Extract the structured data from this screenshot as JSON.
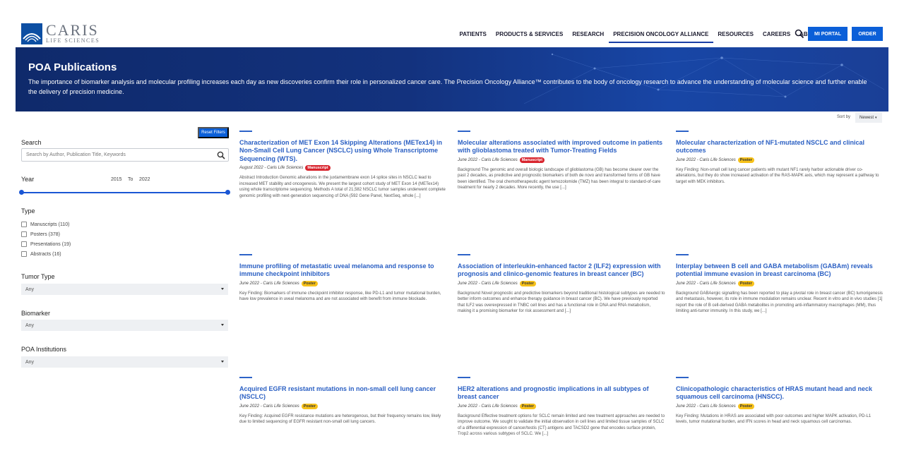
{
  "header": {
    "logo_name": "CARIS",
    "logo_sub": "LIFE SCIENCES",
    "nav": [
      {
        "label": "PATIENTS",
        "active": false
      },
      {
        "label": "PRODUCTS & SERVICES",
        "active": false
      },
      {
        "label": "RESEARCH",
        "active": false
      },
      {
        "label": "PRECISION ONCOLOGY ALLIANCE",
        "active": true
      },
      {
        "label": "RESOURCES",
        "active": false
      },
      {
        "label": "CAREERS",
        "active": false
      },
      {
        "label": "ABOUT",
        "active": false
      }
    ],
    "portal_label": "MI PORTAL",
    "order_label": "ORDER"
  },
  "hero": {
    "title": "POA Publications",
    "text": "The importance of biomarker analysis and molecular profiling increases each day as new discoveries confirm their role in personalized cancer care. The Precision Oncology Alliance™ contributes to the body of oncology research to advance the understanding of molecular science and further enable the delivery of precision medicine."
  },
  "sort": {
    "label": "Sort by",
    "value": "Newest"
  },
  "sidebar": {
    "reset_label": "Reset Filters",
    "search_label": "Search",
    "search_placeholder": "Search by Author, Publication Title, Keywords",
    "year_label": "Year",
    "year_from": "2015",
    "year_to_word": "To",
    "year_to": "2022",
    "type_label": "Type",
    "types": [
      "Manuscripts (110)",
      "Posters (378)",
      "Presentations (19)",
      "Abstracts (16)"
    ],
    "tumor_label": "Tumor Type",
    "tumor_value": "Any",
    "biomarker_label": "Biomarker",
    "biomarker_value": "Any",
    "institutions_label": "POA Institutions",
    "institutions_value": "Any"
  },
  "cards": [
    {
      "title": "Characterization of MET Exon 14 Skipping Alterations (METex14) in Non-Small Cell Lung Cancer (NSCLC) using Whole Transcriptome Sequencing (WTS).",
      "meta": "August 2022 - Caris Life Sciences",
      "badge": "Manuscript",
      "body": "Abstract Introduction Genomic alterations in the juxtamembrane exon 14 splice sites in NSCLC lead to increased MET stability and oncogenesis. We present the largest cohort study of MET Exon 14 (METex14) using whole transcriptome sequencing. Methods A total of 21,582 NSCLC tumor samples underwent complete genomic profiling with next-generation sequencing of DNA (592 Gene Panel, NextSeq, whole [...]"
    },
    {
      "title": "Molecular alterations associated with improved outcome in patients with glioblastoma treated with Tumor-Treating Fields",
      "meta": "June 2022 - Caris Life Sciences",
      "badge": "Manuscript",
      "body": "Background The genomic and overall biologic landscape of glioblastoma (GB) has become clearer over the past 2 decades, as predictive and prognostic biomarkers of both de novo and transformed forms of GB have been identified. The oral chemotherapeutic agent temozolomide (TMZ) has been integral to standard-of-care treatment for nearly 2 decades. More recently, the use [...]"
    },
    {
      "title": "Molecular characterization of NF1-mutated NSCLC and clinical outcomes",
      "meta": "June 2022 - Caris Life Sciences",
      "badge": "Poster",
      "body": "Key Finding: Non-small cell lung cancer patients with mutant NF1 rarely harbor actionable driver co-alterations, but they do show increased activation of the RAS-MAPK axis, which may represent a pathway to target with MEK inhibitors."
    },
    {
      "title": "Immune profiling of metastatic uveal melanoma and response to immune checkpoint inhibitors",
      "meta": "June 2022 - Caris Life Sciences",
      "badge": "Poster",
      "body": "Key Finding: Biomarkers of immune checkpoint inhibitor response, like PD-L1 and tumor mutational burden, have low prevalence in uveal melanoma and are not associated with benefit from immune blockade."
    },
    {
      "title": "Association of interleukin-enhanced factor 2 (ILF2) expression with prognosis and clinico-genomic features in breast cancer (BC)",
      "meta": "June 2022 - Caris Life Sciences",
      "badge": "Poster",
      "body": "Background Novel prognostic and predictive biomarkers beyond traditional histological subtypes are needed to better inform outcomes and enhance therapy guidance in breast cancer (BC). We have previously reported that ILF2 was overexpressed in TNBC cell lines and has a functional role in DNA and RNA metabolism, making it a promising biomarker for risk assessment and [...]"
    },
    {
      "title": "Interplay between B cell and GABA metabolism (GABAm) reveals potential immune evasion in breast carcinoma (BC)",
      "meta": "June 2022 - Caris Life Sciences",
      "badge": "Poster",
      "body": "Background GABAergic signalling has been reported to play a pivotal role in breast cancer (BC) tumorigenesis and metastasis, however, its role in immune modulation remains unclear. Recent in vitro and in vivo studies [1] report the role of B cell-derived GABA metabolites in promoting anti-inflammatory macrophages (MM), thus limiting anti-tumor immunity. In this study, we [...]"
    },
    {
      "title": "Acquired EGFR resistant mutations in non-small cell lung cancer (NSCLC)",
      "meta": "June 2022 - Caris Life Sciences",
      "badge": "Poster",
      "body": "Key Finding: Acquired EGFR resistance mutations are heterogenous, but their frequency remains low, likely due to limited sequencing of EGFR resistant non-small cell lung cancers."
    },
    {
      "title": "HER2 alterations and prognostic implications in all subtypes of breast cancer",
      "meta": "June 2022 - Caris Life Sciences",
      "badge": "Poster",
      "body": "Background Effective treatment options for SCLC remain limited and new treatment approaches are needed to improve outcome. We sought to validate the initial observation in cell lines and limited tissue samples of SCLC of a differential expression of cancer/testis (CT) antigens and TACSD2 gene that encodes surface protein, Trop2 across various subtypes of SCLC. We [...]"
    },
    {
      "title": "Clinicopathologic characteristics of HRAS mutant head and neck squamous cell carcinoma (HNSCC).",
      "meta": "June 2022 - Caris Life Sciences",
      "badge": "Poster",
      "body": "Key Finding: Mutations in HRAS are associated with poor outcomes and higher MAPK activation, PD-L1 levels, tumor mutational burden, and IFN scores in head and neck squamous cell carcinomas."
    }
  ]
}
